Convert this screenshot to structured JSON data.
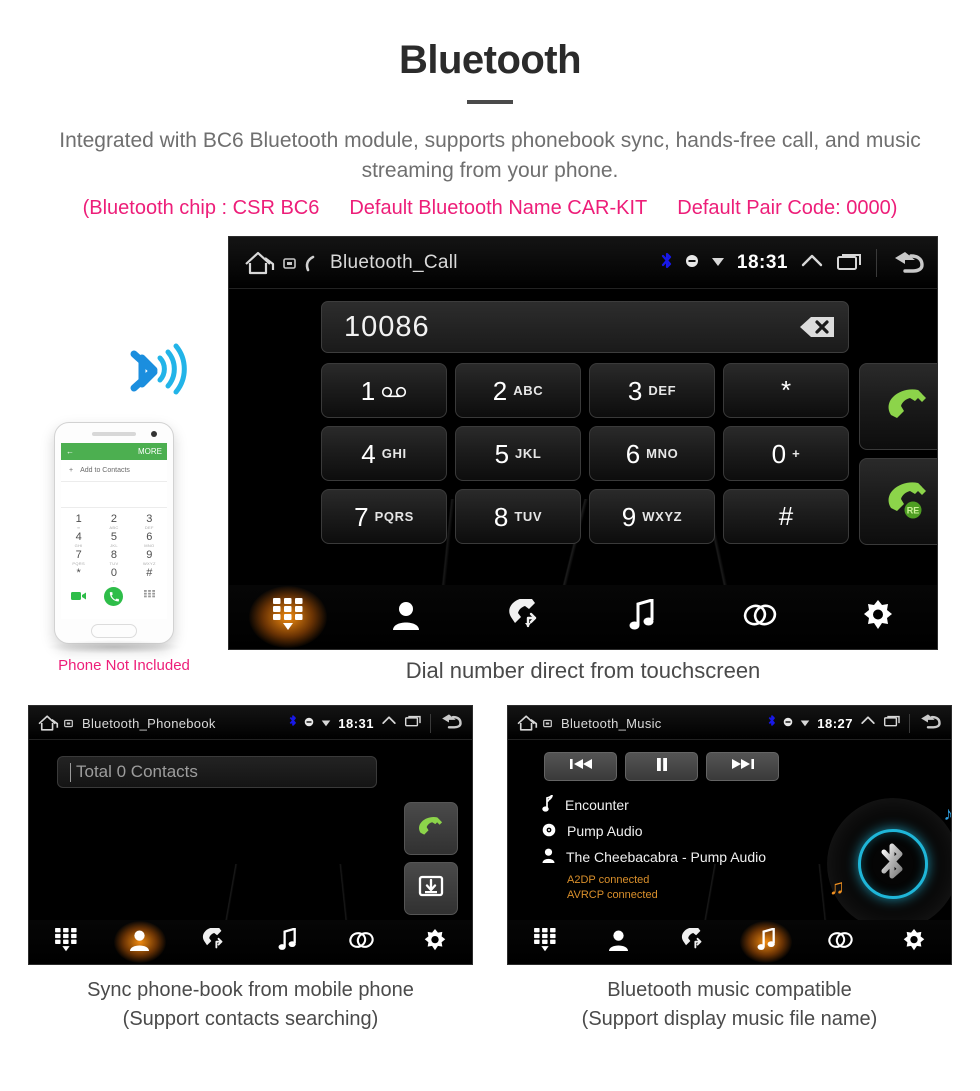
{
  "header": {
    "title": "Bluetooth",
    "subtitle": "Integrated with BC6 Bluetooth module, supports phonebook sync, hands-free call, and music streaming from your phone.",
    "specs": [
      "(Bluetooth chip : CSR BC6",
      "Default Bluetooth Name CAR-KIT",
      "Default Pair Code: 0000)"
    ],
    "accent_pink": "#ED1E79",
    "title_color": "#2B2B2B",
    "subtitle_color": "#6F6F6F"
  },
  "phone_mockup": {
    "note": "Phone Not Included",
    "topbar_more": "MORE",
    "add_contact": "Add to Contacts",
    "keys": [
      {
        "n": "1",
        "s": "∞"
      },
      {
        "n": "2",
        "s": "ABC"
      },
      {
        "n": "3",
        "s": "DEF"
      },
      {
        "n": "4",
        "s": "GHI"
      },
      {
        "n": "5",
        "s": "JKL"
      },
      {
        "n": "6",
        "s": "MNO"
      },
      {
        "n": "7",
        "s": "PQRS"
      },
      {
        "n": "8",
        "s": "TUV"
      },
      {
        "n": "9",
        "s": "WXYZ"
      },
      {
        "n": "*",
        "s": ""
      },
      {
        "n": "0",
        "s": "+"
      },
      {
        "n": "#",
        "s": ""
      }
    ]
  },
  "call_screen": {
    "statusbar": {
      "title": "Bluetooth_Call",
      "time": "18:31",
      "bluetooth_color": "#1818E8"
    },
    "dialed_number": "10086",
    "keypad": [
      {
        "digit": "1",
        "letters": ""
      },
      {
        "digit": "2",
        "letters": "ABC"
      },
      {
        "digit": "3",
        "letters": "DEF"
      },
      {
        "digit": "*",
        "letters": ""
      },
      {
        "digit": "4",
        "letters": "GHI"
      },
      {
        "digit": "5",
        "letters": "JKL"
      },
      {
        "digit": "6",
        "letters": "MNO"
      },
      {
        "digit": "0",
        "letters": "+"
      },
      {
        "digit": "7",
        "letters": "PQRS"
      },
      {
        "digit": "8",
        "letters": "TUV"
      },
      {
        "digit": "9",
        "letters": "WXYZ"
      },
      {
        "digit": "#",
        "letters": ""
      }
    ],
    "redial_badge": "RE",
    "toolbar": [
      {
        "icon": "dialpad-icon",
        "active": true
      },
      {
        "icon": "contacts-icon",
        "active": false
      },
      {
        "icon": "call-history-icon",
        "active": false
      },
      {
        "icon": "music-note-icon",
        "active": false
      },
      {
        "icon": "link-icon",
        "active": false
      },
      {
        "icon": "settings-gear-icon",
        "active": false
      }
    ],
    "caption": "Dial number direct from touchscreen"
  },
  "phonebook_screen": {
    "statusbar": {
      "title": "Bluetooth_Phonebook",
      "time": "18:31"
    },
    "search_placeholder": "Total 0 Contacts",
    "toolbar": [
      {
        "icon": "dialpad-icon",
        "active": false
      },
      {
        "icon": "contacts-icon",
        "active": true
      },
      {
        "icon": "call-history-icon",
        "active": false
      },
      {
        "icon": "music-note-icon",
        "active": false
      },
      {
        "icon": "link-icon",
        "active": false
      },
      {
        "icon": "settings-gear-icon",
        "active": false
      }
    ],
    "caption_line1": "Sync phone-book from mobile phone",
    "caption_line2": "(Support contacts searching)"
  },
  "music_screen": {
    "statusbar": {
      "title": "Bluetooth_Music",
      "time": "18:27"
    },
    "controls": [
      {
        "icon": "previous-track-icon"
      },
      {
        "icon": "pause-icon"
      },
      {
        "icon": "next-track-icon"
      }
    ],
    "track": {
      "title": "Encounter",
      "album": "Pump Audio",
      "artist": "The Cheebacabra - Pump Audio"
    },
    "status_lines": [
      "A2DP connected",
      "AVRCP connected"
    ],
    "status_color": "#D98F2B",
    "accent_cyan": "#1FB6D8",
    "toolbar": [
      {
        "icon": "dialpad-icon",
        "active": false
      },
      {
        "icon": "contacts-icon",
        "active": false
      },
      {
        "icon": "call-history-icon",
        "active": false
      },
      {
        "icon": "music-note-icon",
        "active": true
      },
      {
        "icon": "link-icon",
        "active": false
      },
      {
        "icon": "settings-gear-icon",
        "active": false
      }
    ],
    "caption_line1": "Bluetooth music compatible",
    "caption_line2": "(Support display music file name)"
  }
}
